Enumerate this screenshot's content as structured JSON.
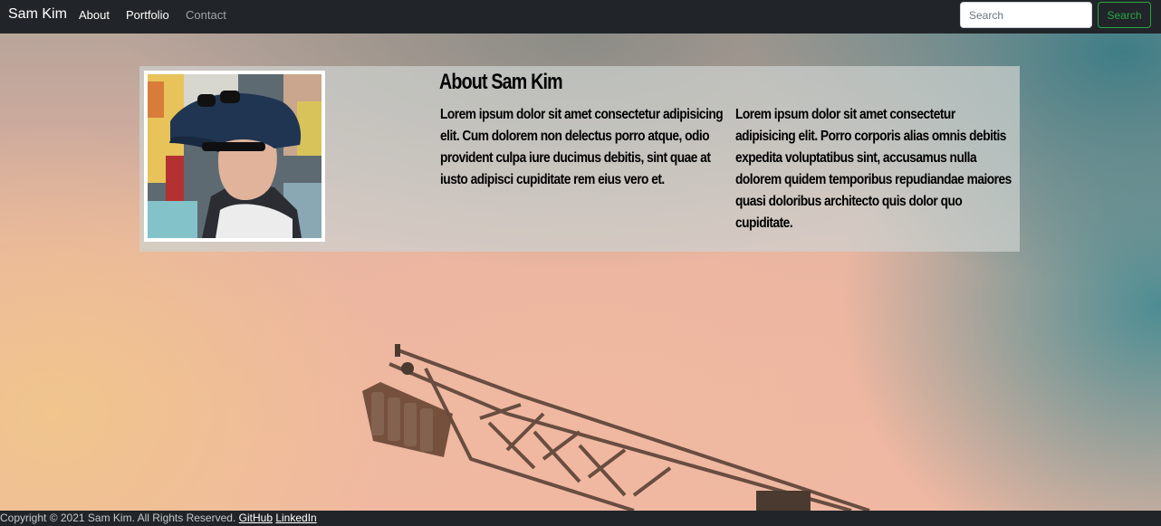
{
  "navbar": {
    "brand": "Sam Kim",
    "links": [
      {
        "label": "About"
      },
      {
        "label": "Portfolio"
      },
      {
        "label": "Contact"
      }
    ],
    "search": {
      "placeholder": "Search",
      "value": ""
    },
    "search_button_label": "Search"
  },
  "about": {
    "title": "About Sam Kim",
    "paragraphs": [
      "Lorem ipsum dolor sit amet consectetur adipisicing elit. Cum dolorem non delectus porro atque, odio provident culpa iure ducimus debitis, sint quae at iusto adipisci cupiditate rem eius vero et.",
      "Lorem ipsum dolor sit amet consectetur adipisicing elit. Porro corporis alias omnis debitis expedita voluptatibus sint, accusamus nulla dolorem quidem temporibus repudiandae maiores quasi doloribus architecto quis dolor quo cupiditate."
    ]
  },
  "footer": {
    "copyright": "Copyright © 2021 Sam Kim. All Rights Reserved.",
    "links": [
      {
        "label": "GitHub"
      },
      {
        "label": "LinkedIn"
      }
    ]
  },
  "colors": {
    "navbar_bg": "#212529",
    "accent_green": "#28a745"
  }
}
